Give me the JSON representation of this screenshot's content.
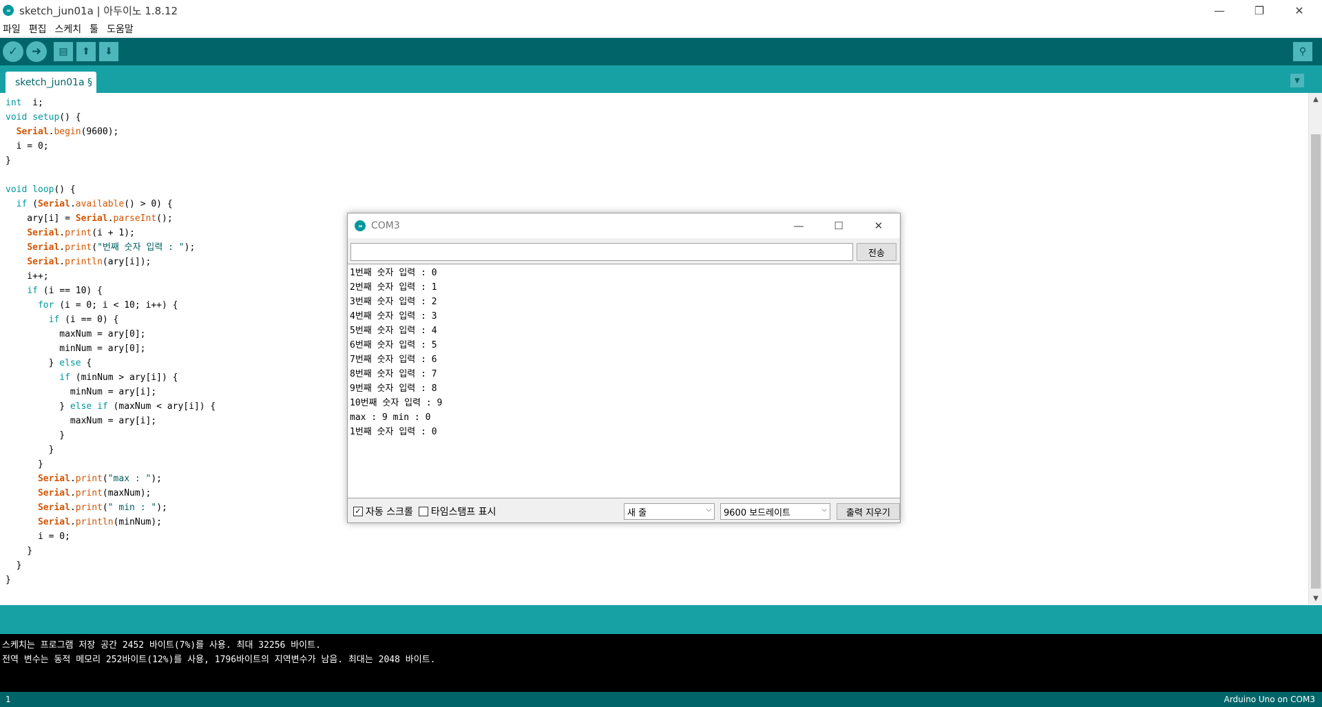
{
  "window": {
    "title": "sketch_jun01a | 아두이노 1.8.12",
    "logo": "∞",
    "minimize": "—",
    "restore": "❐",
    "close": "✕"
  },
  "menu": [
    "파일",
    "편집",
    "스케치",
    "툴",
    "도움말"
  ],
  "toolbar": {
    "verify": "✓",
    "upload": "➜",
    "new": "▤",
    "open": "⬆",
    "save": "⬇",
    "serial_monitor": "⚲"
  },
  "tab": {
    "label": "sketch_jun01a §",
    "menu": "▼"
  },
  "code_lines": [
    [
      [
        "kw",
        "int"
      ],
      [
        "",
        "  i;"
      ]
    ],
    [
      [
        "kw",
        "void"
      ],
      [
        "",
        " "
      ],
      [
        "kw",
        "setup"
      ],
      [
        "",
        "() {"
      ]
    ],
    [
      [
        "",
        "  "
      ],
      [
        "obj",
        "Serial"
      ],
      [
        "",
        "."
      ],
      [
        "fn",
        "begin"
      ],
      [
        "",
        "(9600);"
      ]
    ],
    [
      [
        "",
        "  i = 0;"
      ]
    ],
    [
      [
        "",
        "}"
      ]
    ],
    [
      [
        "",
        ""
      ]
    ],
    [
      [
        "kw",
        "void"
      ],
      [
        "",
        " "
      ],
      [
        "kw",
        "loop"
      ],
      [
        "",
        "() {"
      ]
    ],
    [
      [
        "",
        "  "
      ],
      [
        "kw",
        "if"
      ],
      [
        "",
        " ("
      ],
      [
        "obj",
        "Serial"
      ],
      [
        "",
        "."
      ],
      [
        "fn",
        "available"
      ],
      [
        "",
        "() > 0) {"
      ]
    ],
    [
      [
        "",
        "    ary[i] = "
      ],
      [
        "obj",
        "Serial"
      ],
      [
        "",
        "."
      ],
      [
        "fn",
        "parseInt"
      ],
      [
        "",
        "();"
      ]
    ],
    [
      [
        "",
        "    "
      ],
      [
        "obj",
        "Serial"
      ],
      [
        "",
        "."
      ],
      [
        "fn",
        "print"
      ],
      [
        "",
        "(i + 1);"
      ]
    ],
    [
      [
        "",
        "    "
      ],
      [
        "obj",
        "Serial"
      ],
      [
        "",
        "."
      ],
      [
        "fn",
        "print"
      ],
      [
        "",
        "("
      ],
      [
        "str",
        "\"번째 숫자 입력 : \""
      ],
      [
        "",
        ");"
      ]
    ],
    [
      [
        "",
        "    "
      ],
      [
        "obj",
        "Serial"
      ],
      [
        "",
        "."
      ],
      [
        "fn",
        "println"
      ],
      [
        "",
        "(ary[i]);"
      ]
    ],
    [
      [
        "",
        "    i++;"
      ]
    ],
    [
      [
        "",
        "    "
      ],
      [
        "kw",
        "if"
      ],
      [
        "",
        " (i == 10) {"
      ]
    ],
    [
      [
        "",
        "      "
      ],
      [
        "kw",
        "for"
      ],
      [
        "",
        " (i = 0; i < 10; i++) {"
      ]
    ],
    [
      [
        "",
        "        "
      ],
      [
        "kw",
        "if"
      ],
      [
        "",
        " (i == 0) {"
      ]
    ],
    [
      [
        "",
        "          maxNum = ary[0];"
      ]
    ],
    [
      [
        "",
        "          minNum = ary[0];"
      ]
    ],
    [
      [
        "",
        "        } "
      ],
      [
        "kw",
        "else"
      ],
      [
        "",
        " {"
      ]
    ],
    [
      [
        "",
        "          "
      ],
      [
        "kw",
        "if"
      ],
      [
        "",
        " (minNum > ary[i]) {"
      ]
    ],
    [
      [
        "",
        "            minNum = ary[i];"
      ]
    ],
    [
      [
        "",
        "          } "
      ],
      [
        "kw",
        "else"
      ],
      [
        "",
        " "
      ],
      [
        "kw",
        "if"
      ],
      [
        "",
        " (maxNum < ary[i]) {"
      ]
    ],
    [
      [
        "",
        "            maxNum = ary[i];"
      ]
    ],
    [
      [
        "",
        "          }"
      ]
    ],
    [
      [
        "",
        "        }"
      ]
    ],
    [
      [
        "",
        "      }"
      ]
    ],
    [
      [
        "",
        "      "
      ],
      [
        "obj",
        "Serial"
      ],
      [
        "",
        "."
      ],
      [
        "fn",
        "print"
      ],
      [
        "",
        "("
      ],
      [
        "str",
        "\"max : \""
      ],
      [
        "",
        ");"
      ]
    ],
    [
      [
        "",
        "      "
      ],
      [
        "obj",
        "Serial"
      ],
      [
        "",
        "."
      ],
      [
        "fn",
        "print"
      ],
      [
        "",
        "(maxNum);"
      ]
    ],
    [
      [
        "",
        "      "
      ],
      [
        "obj",
        "Serial"
      ],
      [
        "",
        "."
      ],
      [
        "fn",
        "print"
      ],
      [
        "",
        "("
      ],
      [
        "str",
        "\" min : \""
      ],
      [
        "",
        ");"
      ]
    ],
    [
      [
        "",
        "      "
      ],
      [
        "obj",
        "Serial"
      ],
      [
        "",
        "."
      ],
      [
        "fn",
        "println"
      ],
      [
        "",
        "(minNum);"
      ]
    ],
    [
      [
        "",
        "      i = 0;"
      ]
    ],
    [
      [
        "",
        "    }"
      ]
    ],
    [
      [
        "",
        "  }"
      ]
    ],
    [
      [
        "",
        "}"
      ]
    ]
  ],
  "monitor": {
    "title": "COM3",
    "input_value": "",
    "send_label": "전송",
    "output_lines": [
      "1번째 숫자 입력 : 0",
      "2번째 숫자 입력 : 1",
      "3번째 숫자 입력 : 2",
      "4번째 숫자 입력 : 3",
      "5번째 숫자 입력 : 4",
      "6번째 숫자 입력 : 5",
      "7번째 숫자 입력 : 6",
      "8번째 숫자 입력 : 7",
      "9번째 숫자 입력 : 8",
      "10번째 숫자 입력 : 9",
      "max : 9 min : 0",
      "1번째 숫자 입력 : 0"
    ],
    "autoscroll_label": "자동 스크롤",
    "autoscroll_checked": true,
    "timestamp_label": "타임스탬프 표시",
    "timestamp_checked": false,
    "line_ending": "새 줄",
    "baud_rate": "9600 보드레이트",
    "clear_label": "출력 지우기"
  },
  "console_lines": [
    "스케치는 프로그램 저장 공간 2452 바이트(7%)를 사용. 최대 32256 바이트.",
    "전역 변수는 동적 메모리 252바이트(12%)를 사용, 1796바이트의 지역변수가 남음.  최대는 2048 바이트."
  ],
  "status": {
    "line_number": "1",
    "board": "Arduino Uno on COM3"
  },
  "colors": {
    "toolbar": "#006468",
    "tabbar": "#17a1a5",
    "keyword": "#00979c",
    "object": "#d35400"
  }
}
